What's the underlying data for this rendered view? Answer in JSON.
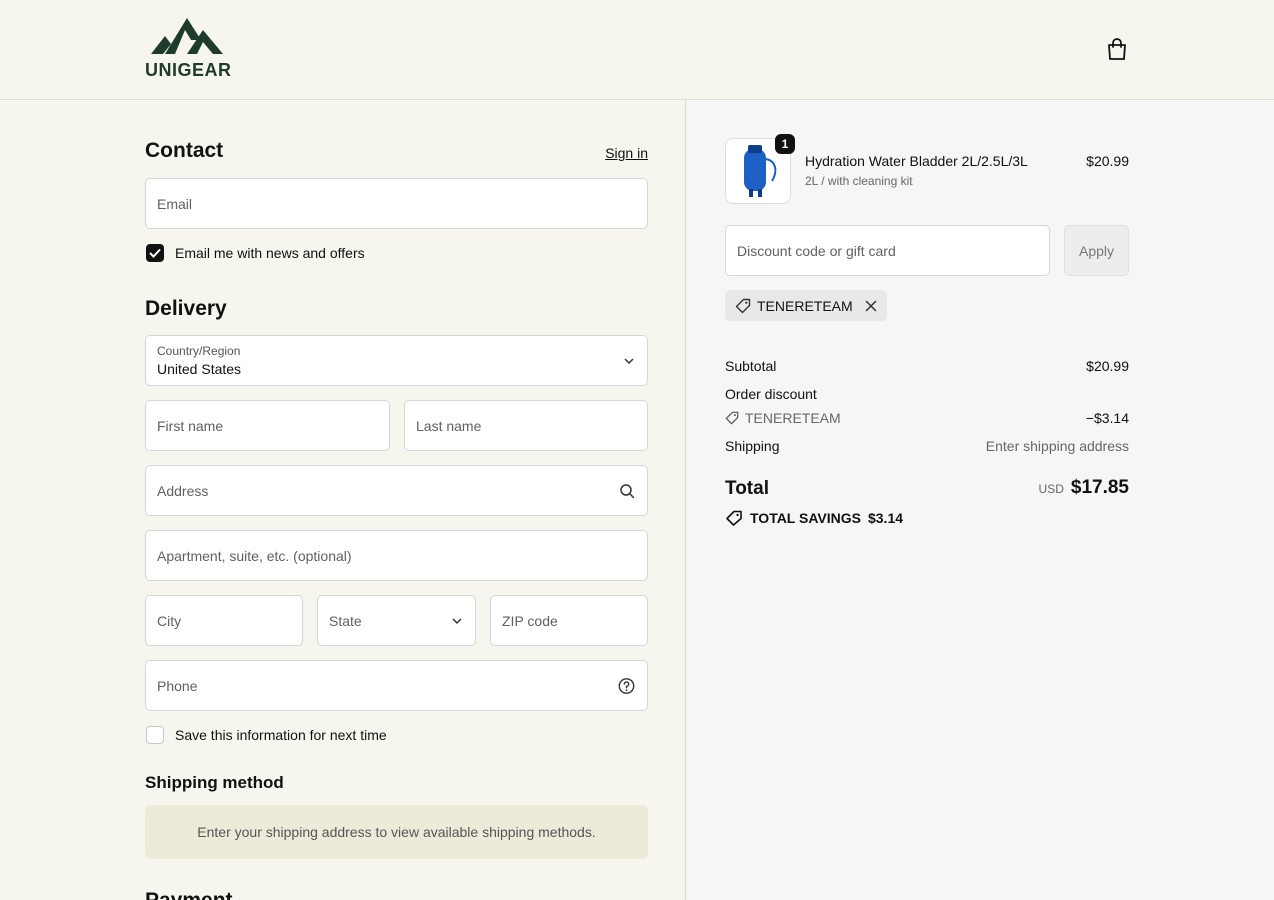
{
  "brand": {
    "name": "UNIGEAR",
    "color": "#1f3b2b"
  },
  "contact": {
    "heading": "Contact",
    "sign_in": "Sign in",
    "email_placeholder": "Email",
    "newsletter_label": "Email me with news and offers",
    "newsletter_checked": true
  },
  "delivery": {
    "heading": "Delivery",
    "country_label": "Country/Region",
    "country_value": "United States",
    "first_name": "First name",
    "last_name": "Last name",
    "address": "Address",
    "apartment": "Apartment, suite, etc. (optional)",
    "city": "City",
    "state": "State",
    "zip": "ZIP code",
    "phone": "Phone",
    "save_info_label": "Save this information for next time",
    "save_info_checked": false
  },
  "shipping_method": {
    "heading": "Shipping method",
    "message": "Enter your shipping address to view available shipping methods."
  },
  "payment": {
    "heading": "Payment"
  },
  "cart": {
    "item": {
      "name": "Hydration Water Bladder 2L/2.5L/3L",
      "variant": "2L / with cleaning kit",
      "price": "$20.99",
      "quantity": "1"
    },
    "discount_placeholder": "Discount code or gift card",
    "apply_label": "Apply",
    "applied_code": "TENERETEAM"
  },
  "summary": {
    "subtotal_label": "Subtotal",
    "subtotal_value": "$20.99",
    "order_discount_label": "Order discount",
    "discount_code": "TENERETEAM",
    "discount_value": "−$3.14",
    "shipping_label": "Shipping",
    "shipping_value": "Enter shipping address",
    "total_label": "Total",
    "currency": "USD",
    "total_value": "$17.85",
    "savings_label": "TOTAL SAVINGS",
    "savings_value": "$3.14"
  },
  "icons": {
    "cart": "shopping-bag-icon",
    "search": "search-icon",
    "help": "question-circle-icon",
    "chevron": "chevron-down-icon",
    "tag": "tag-icon",
    "close": "close-icon"
  }
}
